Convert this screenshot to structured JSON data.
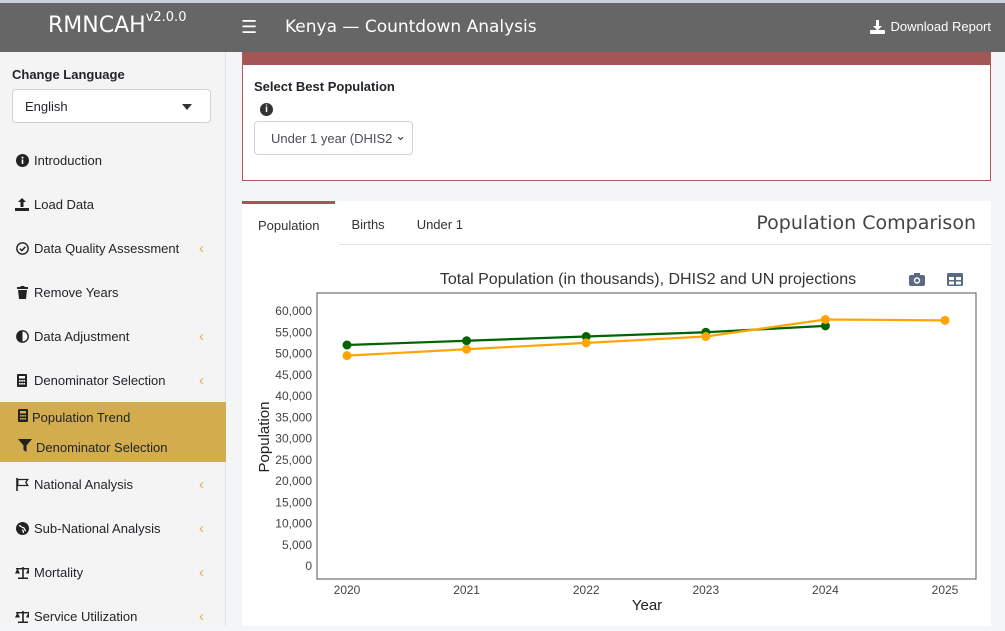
{
  "header": {
    "brand": "RMNCAH",
    "version": "v2.0.0",
    "title": "Kenya — Countdown Analysis",
    "download_label": "Download Report"
  },
  "sidebar": {
    "change_language": "Change Language",
    "language_value": "English",
    "items": [
      {
        "label": "Introduction",
        "icon": "info-circle-icon"
      },
      {
        "label": "Load Data",
        "icon": "upload-icon"
      },
      {
        "label": "Data Quality Assessment",
        "icon": "check-circle-icon"
      },
      {
        "label": "Remove Years",
        "icon": "trash-icon"
      },
      {
        "label": "Data Adjustment",
        "icon": "adjust-icon"
      },
      {
        "label": "Denominator Selection",
        "icon": "calculator-icon"
      },
      {
        "label": "Population Trend",
        "icon": "calculator-icon"
      },
      {
        "label": "Denominator Selection",
        "icon": "filter-icon"
      },
      {
        "label": "National Analysis",
        "icon": "flag-icon"
      },
      {
        "label": "Sub-National Analysis",
        "icon": "globe-icon"
      },
      {
        "label": "Mortality",
        "icon": "balance-scale-icon"
      },
      {
        "label": "Service Utilization",
        "icon": "balance-scale-icon"
      }
    ]
  },
  "select_box": {
    "label": "Select Best Population",
    "value": "Under 1 year (DHIS2"
  },
  "tabs": [
    "Population",
    "Births",
    "Under 1"
  ],
  "panel_title": "Population Comparison",
  "chart_data": {
    "type": "line",
    "title": "Total Population (in thousands), DHIS2 and UN projections",
    "xlabel": "Year",
    "ylabel": "Population",
    "x": [
      2020,
      2021,
      2022,
      2023,
      2024,
      2025
    ],
    "ylim": [
      0,
      60000
    ],
    "yticks": [
      "0",
      "5,000",
      "10,000",
      "15,000",
      "20,000",
      "25,000",
      "30,000",
      "35,000",
      "40,000",
      "45,000",
      "50,000",
      "55,000",
      "60,000"
    ],
    "series": [
      {
        "color": "#006400",
        "values": [
          52000,
          53000,
          54000,
          55000,
          56500,
          null
        ]
      },
      {
        "color": "#ffa500",
        "values": [
          49500,
          51000,
          52500,
          54000,
          58000,
          57800
        ]
      }
    ]
  }
}
